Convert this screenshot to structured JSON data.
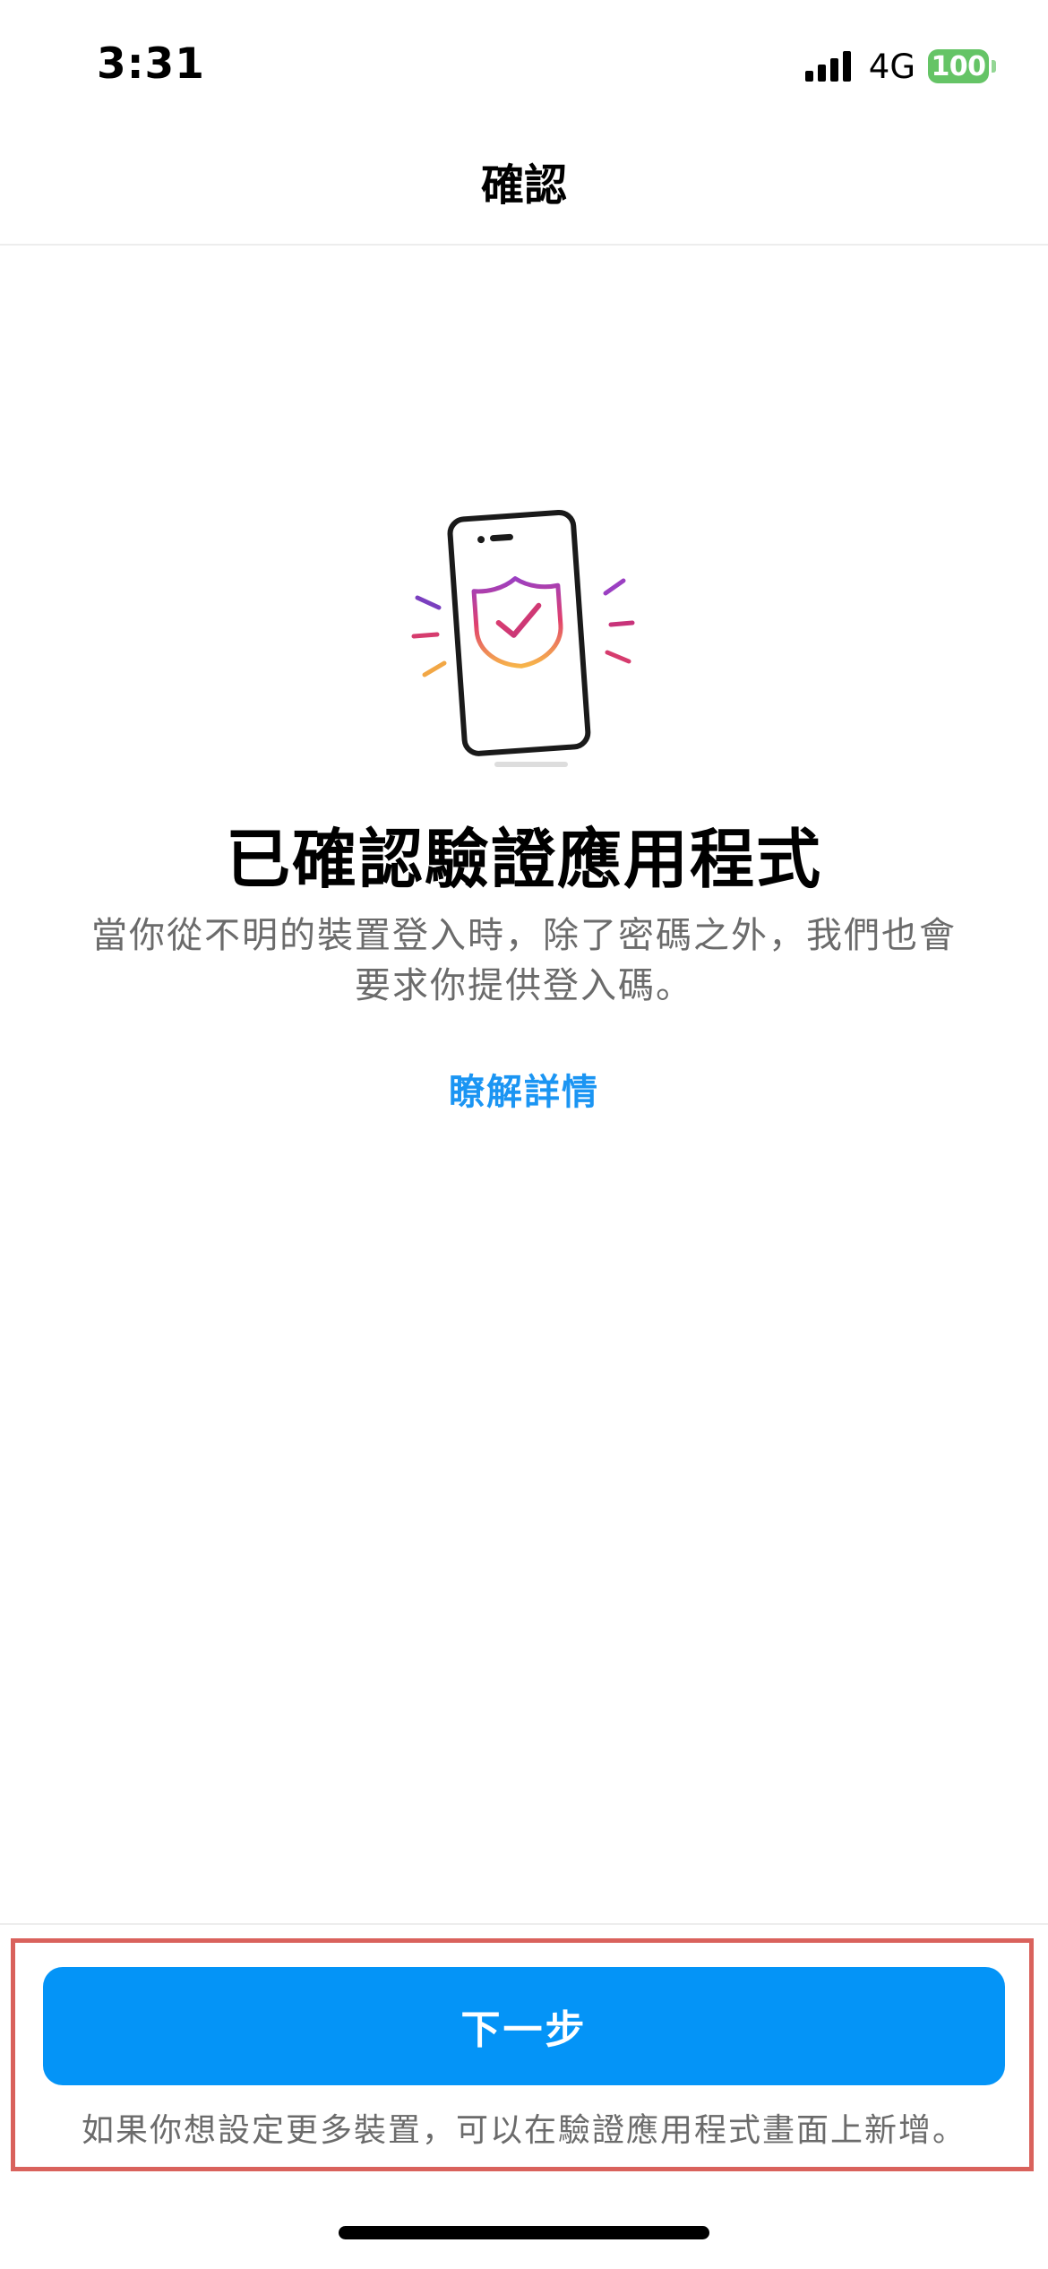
{
  "status_bar": {
    "time": "3:31",
    "network": "4G",
    "battery_level": "100",
    "battery_color": "#65c466"
  },
  "header": {
    "title": "確認"
  },
  "hero": {
    "icon": "phone-shield-check-icon"
  },
  "main": {
    "headline": "已確認驗證應用程式",
    "description": "當你從不明的裝置登入時，除了密碼之外，我們也會要求你提供登入碼。",
    "learn_more": "瞭解詳情"
  },
  "footer": {
    "next_button": "下一步",
    "note": "如果你想設定更多裝置，可以在驗證應用程式畫面上新增。"
  },
  "colors": {
    "accent_blue": "#0494f7",
    "link_blue": "#1b95f3",
    "highlight_red": "#d9625c"
  }
}
